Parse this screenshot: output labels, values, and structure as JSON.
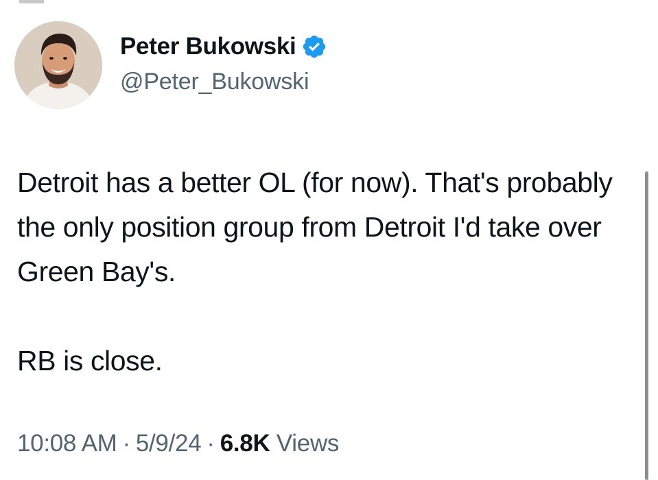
{
  "author": {
    "display_name": "Peter Bukowski",
    "handle": "@Peter_Bukowski",
    "verified": true,
    "verified_badge_color": "#1d9bf0"
  },
  "tweet": {
    "paragraphs": [
      "Detroit has a better OL (for now). That's probably the only position group from Detroit I'd take over Green Bay's.",
      "RB is close."
    ]
  },
  "meta": {
    "time": "10:08 AM",
    "separator": "·",
    "date": "5/9/24",
    "views_count": "6.8K",
    "views_label": "Views"
  },
  "colors": {
    "text_primary": "#0f1419",
    "text_secondary": "#536471"
  },
  "icons": {
    "verified": "verified-badge-icon",
    "avatar": "profile-avatar"
  }
}
